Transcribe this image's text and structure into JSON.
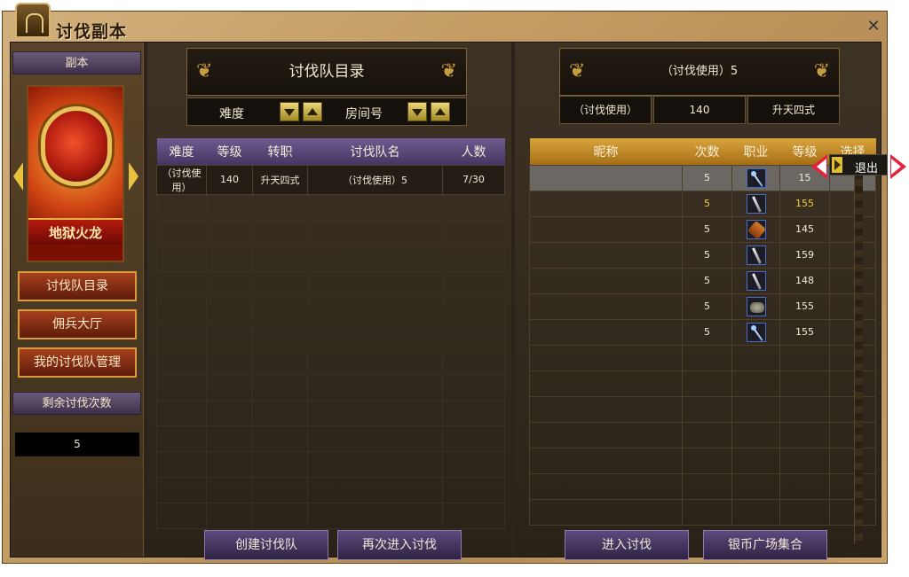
{
  "window": {
    "title": "讨伐副本",
    "close_label": "✕"
  },
  "sidebar": {
    "header": "副本",
    "dungeon_name": "地狱火龙",
    "nav": [
      {
        "label": "讨伐队目录"
      },
      {
        "label": "佣兵大厅"
      },
      {
        "label": "我的讨伐队管理"
      }
    ],
    "remaining_label": "剩余讨伐次数",
    "remaining_value": "5"
  },
  "center": {
    "header": "讨伐队目录",
    "difficulty_label": "难度",
    "room_label": "房间号",
    "columns": [
      "难度",
      "等级",
      "转职",
      "讨伐队名",
      "人数"
    ],
    "rows": [
      {
        "difficulty": "（讨伐使用）",
        "level": "140",
        "job": "升天四式",
        "team_name": "（讨伐使用）5",
        "count": "7/30"
      }
    ],
    "buttons": {
      "create": "创建讨伐队",
      "reenter": "再次进入讨伐"
    }
  },
  "right": {
    "header": "（讨伐使用）5",
    "info": {
      "difficulty": "（讨伐使用）",
      "level": "140",
      "job": "升天四式"
    },
    "columns": [
      "昵称",
      "次数",
      "职业",
      "等级",
      "选择"
    ],
    "members": [
      {
        "nickname": "",
        "times": "5",
        "job_icon": "staff-icon",
        "level": "15"
      },
      {
        "nickname": "",
        "times": "5",
        "job_icon": "sword-icon",
        "level": "155"
      },
      {
        "nickname": "",
        "times": "5",
        "job_icon": "axe-icon",
        "level": "145"
      },
      {
        "nickname": "",
        "times": "5",
        "job_icon": "sword-icon",
        "level": "159"
      },
      {
        "nickname": "",
        "times": "5",
        "job_icon": "sword-icon",
        "level": "148"
      },
      {
        "nickname": "",
        "times": "5",
        "job_icon": "fist-icon",
        "level": "155"
      },
      {
        "nickname": "",
        "times": "5",
        "job_icon": "staff-icon",
        "level": "155"
      }
    ],
    "buttons": {
      "enter": "进入讨伐",
      "gather": "银币广场集合"
    },
    "exit_label": "退出"
  },
  "colors": {
    "accent_purple": "#5d4a7e",
    "accent_gold": "#d9a43c",
    "annotation_red": "#e8203c",
    "highlight_yellow": "#f1cc3a"
  }
}
